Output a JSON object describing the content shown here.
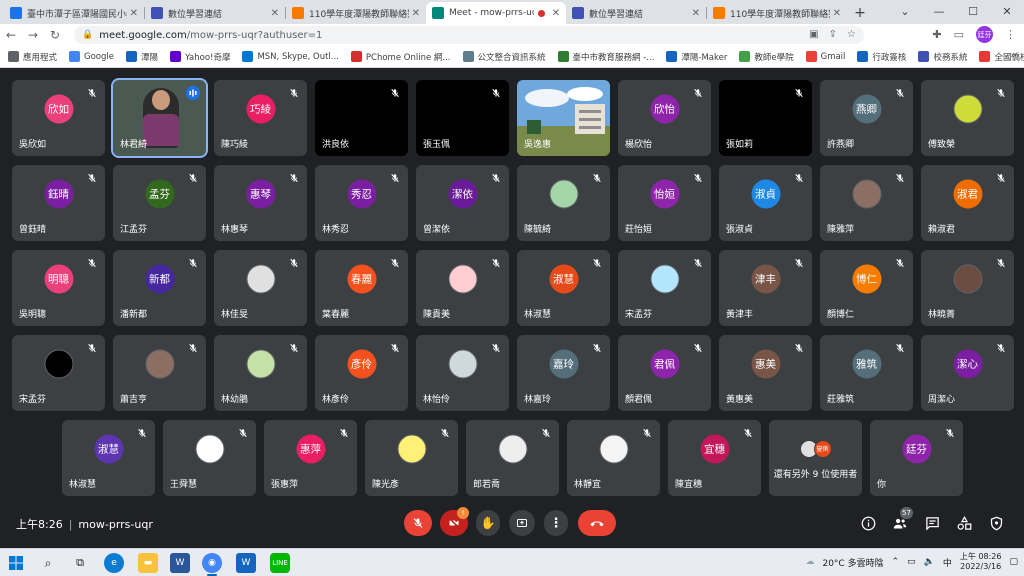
{
  "browser": {
    "tabs": [
      {
        "title": "臺中市潭子區潭陽國民小學",
        "favicon_color": "#1a73e8",
        "active": false
      },
      {
        "title": "數位學習連結",
        "favicon_color": "#3f51b5",
        "active": false
      },
      {
        "title": "110學年度潭陽教師聯絡簿",
        "favicon_color": "#f57c00",
        "active": false
      },
      {
        "title": "Meet - mow-prrs-uqr",
        "favicon_color": "#00897b",
        "active": true
      },
      {
        "title": "數位學習連結",
        "favicon_color": "#3f51b5",
        "active": false
      },
      {
        "title": "110學年度潭陽教師聯絡簿",
        "favicon_color": "#f57c00",
        "active": false
      }
    ],
    "url_host": "meet.google.com",
    "url_path": "/mow-prrs-uqr?authuser=1",
    "profile_initials": "廷芬",
    "bookmarks": [
      {
        "label": "應用程式",
        "color": "#5f6368"
      },
      {
        "label": "Google",
        "color": "#4285f4"
      },
      {
        "label": "潭陽",
        "color": "#1565c0"
      },
      {
        "label": "Yahoo!奇摩",
        "color": "#6001d2"
      },
      {
        "label": "MSN, Skype, Outl...",
        "color": "#0078d4"
      },
      {
        "label": "PChome Online 網...",
        "color": "#d32f2f"
      },
      {
        "label": "公文整合資訊系統",
        "color": "#607d8b"
      },
      {
        "label": "臺中市教育服務網 -...",
        "color": "#2e7d32"
      },
      {
        "label": "潭陽-Maker",
        "color": "#1565c0"
      },
      {
        "label": "教師e學院",
        "color": "#43a047"
      },
      {
        "label": "Gmail",
        "color": "#ea4335"
      },
      {
        "label": "行政簽核",
        "color": "#1565c0"
      },
      {
        "label": "校務系統",
        "color": "#3f51b5"
      },
      {
        "label": "全國僑校",
        "color": "#e53935"
      }
    ]
  },
  "meeting": {
    "code": "mow-prrs-uqr",
    "time": "上午8:26",
    "participant_count": "57",
    "chat_badge": "!",
    "rows": [
      [
        {
          "name": "吳欣如",
          "avatar_text": "欣如",
          "avatar_color": "#ec407a",
          "type": "avatar"
        },
        {
          "name": "林君綺",
          "avatar_text": "",
          "avatar_color": "#5f6368",
          "type": "video",
          "speaking": true
        },
        {
          "name": "陳巧綾",
          "avatar_text": "巧綾",
          "avatar_color": "#e91e63",
          "type": "avatar"
        },
        {
          "name": "洪良依",
          "avatar_text": "",
          "avatar_color": "",
          "type": "black"
        },
        {
          "name": "張玉佩",
          "avatar_text": "",
          "avatar_color": "",
          "type": "black"
        },
        {
          "name": "吳逸惠",
          "avatar_text": "",
          "avatar_color": "",
          "type": "photo"
        },
        {
          "name": "楊欣怡",
          "avatar_text": "欣怡",
          "avatar_color": "#8e24aa",
          "type": "avatar"
        },
        {
          "name": "張如莉",
          "avatar_text": "",
          "avatar_color": "",
          "type": "black"
        },
        {
          "name": "許燕卿",
          "avatar_text": "燕卿",
          "avatar_color": "#546e7a",
          "type": "avatar"
        },
        {
          "name": "傅致榮",
          "avatar_text": "",
          "avatar_color": "#cddc39",
          "type": "image"
        }
      ],
      [
        {
          "name": "曾鈺晴",
          "avatar_text": "鈺晴",
          "avatar_color": "#7b1fa2",
          "type": "avatar"
        },
        {
          "name": "江孟芬",
          "avatar_text": "孟芬",
          "avatar_color": "#33691e",
          "type": "avatar"
        },
        {
          "name": "林惠琴",
          "avatar_text": "惠琴",
          "avatar_color": "#7b1fa2",
          "type": "avatar"
        },
        {
          "name": "林秀忍",
          "avatar_text": "秀忍",
          "avatar_color": "#7b1fa2",
          "type": "avatar"
        },
        {
          "name": "曾潔依",
          "avatar_text": "潔依",
          "avatar_color": "#6a1b9a",
          "type": "avatar"
        },
        {
          "name": "陳毓綺",
          "avatar_text": "",
          "avatar_color": "#a5d6a7",
          "type": "image"
        },
        {
          "name": "莊怡姮",
          "avatar_text": "怡姮",
          "avatar_color": "#8e24aa",
          "type": "avatar"
        },
        {
          "name": "張淑貞",
          "avatar_text": "淑貞",
          "avatar_color": "#1e88e5",
          "type": "avatar"
        },
        {
          "name": "陳雅萍",
          "avatar_text": "",
          "avatar_color": "#8d6e63",
          "type": "image"
        },
        {
          "name": "賴淑君",
          "avatar_text": "淑君",
          "avatar_color": "#ef6c00",
          "type": "avatar"
        }
      ],
      [
        {
          "name": "吳明聰",
          "avatar_text": "明聰",
          "avatar_color": "#ec407a",
          "type": "avatar"
        },
        {
          "name": "潘新都",
          "avatar_text": "新都",
          "avatar_color": "#4527a0",
          "type": "avatar"
        },
        {
          "name": "林佳旻",
          "avatar_text": "",
          "avatar_color": "#e0e0e0",
          "type": "image"
        },
        {
          "name": "葉春麗",
          "avatar_text": "春麗",
          "avatar_color": "#f4511e",
          "type": "avatar"
        },
        {
          "name": "陳貴美",
          "avatar_text": "",
          "avatar_color": "#ffcdd2",
          "type": "image"
        },
        {
          "name": "林淑慧",
          "avatar_text": "淑慧",
          "avatar_color": "#e64a19",
          "type": "avatar"
        },
        {
          "name": "宋孟芬",
          "avatar_text": "",
          "avatar_color": "#b3e5fc",
          "type": "image"
        },
        {
          "name": "黃津丰",
          "avatar_text": "津丰",
          "avatar_color": "#795548",
          "type": "avatar"
        },
        {
          "name": "顏博仁",
          "avatar_text": "博仁",
          "avatar_color": "#f57c00",
          "type": "avatar"
        },
        {
          "name": "林曉菁",
          "avatar_text": "",
          "avatar_color": "#6d4c41",
          "type": "image"
        }
      ],
      [
        {
          "name": "宋孟芬",
          "avatar_text": "",
          "avatar_color": "#000000",
          "type": "image"
        },
        {
          "name": "蕭吉亨",
          "avatar_text": "",
          "avatar_color": "#8d6e63",
          "type": "image"
        },
        {
          "name": "林幼鵑",
          "avatar_text": "",
          "avatar_color": "#c5e1a5",
          "type": "image"
        },
        {
          "name": "林彥伶",
          "avatar_text": "彥伶",
          "avatar_color": "#f4511e",
          "type": "avatar"
        },
        {
          "name": "林怡伶",
          "avatar_text": "",
          "avatar_color": "#cfd8dc",
          "type": "image"
        },
        {
          "name": "林嘉玲",
          "avatar_text": "嘉玲",
          "avatar_color": "#546e7a",
          "type": "avatar"
        },
        {
          "name": "顏君佩",
          "avatar_text": "君佩",
          "avatar_color": "#8e24aa",
          "type": "avatar"
        },
        {
          "name": "黃惠美",
          "avatar_text": "惠美",
          "avatar_color": "#795548",
          "type": "avatar"
        },
        {
          "name": "莊雅筑",
          "avatar_text": "雅筑",
          "avatar_color": "#546e7a",
          "type": "avatar"
        },
        {
          "name": "周潔心",
          "avatar_text": "潔心",
          "avatar_color": "#7b1fa2",
          "type": "avatar"
        }
      ],
      [
        {
          "name": "林淑慧",
          "avatar_text": "淑慧",
          "avatar_color": "#5e35b1",
          "type": "avatar"
        },
        {
          "name": "王舜慧",
          "avatar_text": "",
          "avatar_color": "#ffffff",
          "type": "image"
        },
        {
          "name": "張惠萍",
          "avatar_text": "惠萍",
          "avatar_color": "#e91e63",
          "type": "avatar"
        },
        {
          "name": "陳光彥",
          "avatar_text": "",
          "avatar_color": "#fff176",
          "type": "image"
        },
        {
          "name": "郎若喬",
          "avatar_text": "",
          "avatar_color": "#eeeeee",
          "type": "image"
        },
        {
          "name": "林靜宜",
          "avatar_text": "",
          "avatar_color": "#f5f5f5",
          "type": "image"
        },
        {
          "name": "陳宜穗",
          "avatar_text": "宜穗",
          "avatar_color": "#c2185b",
          "type": "avatar"
        },
        {
          "name": "還有另外 9 位使用者",
          "avatar_text": "燮俐",
          "avatar_color": "#e64a19",
          "type": "more"
        },
        {
          "name": "你",
          "avatar_text": "廷芬",
          "avatar_color": "#8e24aa",
          "type": "avatar"
        }
      ]
    ]
  },
  "taskbar": {
    "weather": "20°C 多雲時陰",
    "ime": "中",
    "time_line1": "上午 08:26",
    "time_line2": "2022/3/16"
  }
}
